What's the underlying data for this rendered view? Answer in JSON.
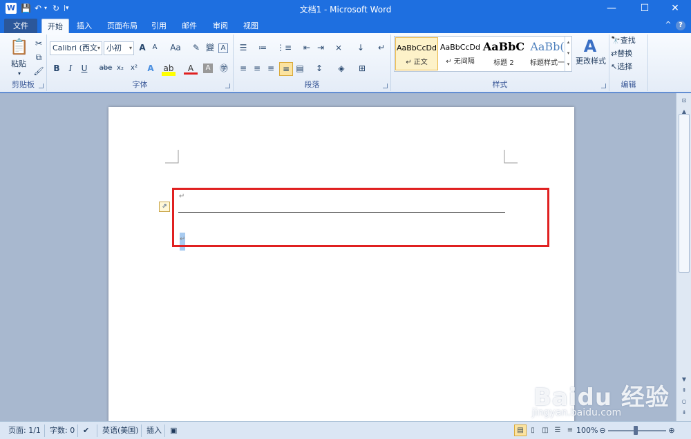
{
  "titlebar": {
    "logo": "W",
    "title": "文档1 - Microsoft Word",
    "minimize": "—",
    "maximize": "☐",
    "close": "✕"
  },
  "tabs": {
    "file": "文件",
    "items": [
      "开始",
      "插入",
      "页面布局",
      "引用",
      "邮件",
      "审阅",
      "视图"
    ]
  },
  "ribbon": {
    "clipboard": {
      "label": "剪贴板",
      "paste": "粘贴"
    },
    "font": {
      "label": "字体",
      "font_name": "Calibri (西文",
      "font_size": "小初",
      "bold": "B",
      "italic": "I",
      "underline": "U",
      "strike": "abe",
      "subscript": "x₂",
      "superscript": "x²",
      "change_case": "Aa",
      "grow": "A",
      "shrink": "A"
    },
    "paragraph": {
      "label": "段落"
    },
    "styles": {
      "label": "样式",
      "items": [
        {
          "sample": "AaBbCcDd",
          "name": "↵ 正文"
        },
        {
          "sample": "AaBbCcDd",
          "name": "↵ 无间隔"
        },
        {
          "sample": "AaBbC",
          "name": "标题 2"
        },
        {
          "sample": "AaBb(",
          "name": "标题样式一"
        }
      ],
      "change_styles": "更改样式"
    },
    "editing": {
      "label": "编辑",
      "find": "查找",
      "replace": "替换",
      "select": "选择"
    }
  },
  "document": {
    "paragraph_mark": "↵",
    "paragraph_mark_2": "↵"
  },
  "statusbar": {
    "page": "页面: 1/1",
    "words": "字数: 0",
    "language": "英语(美国)",
    "mode": "插入",
    "zoom": "100%"
  },
  "watermark": {
    "text": "Baidu 经验",
    "url": "jingyan.baidu.com"
  }
}
